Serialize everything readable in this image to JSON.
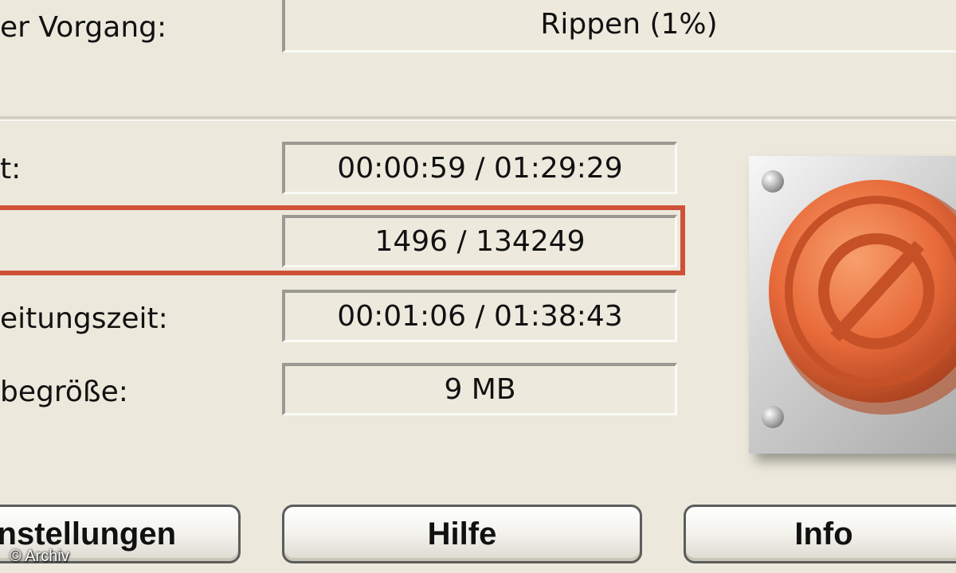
{
  "operation": {
    "label": "er Vorgang:",
    "value": "Rippen (1%)"
  },
  "rows": [
    {
      "label": "t:",
      "value": "00:00:59 / 01:29:29"
    },
    {
      "label": "",
      "value": "1496 / 134249"
    },
    {
      "label": "eitungszeit:",
      "value": "00:01:06 / 01:38:43"
    },
    {
      "label": "begröße:",
      "value": "9 MB"
    }
  ],
  "buttons": {
    "settings": "nstellungen",
    "help": "Hilfe",
    "info": "Info"
  },
  "stop_button": {
    "icon": "stop-icon",
    "color": "#e86a3a"
  },
  "highlight_color": "#cf5238",
  "watermark": "© Archiv"
}
